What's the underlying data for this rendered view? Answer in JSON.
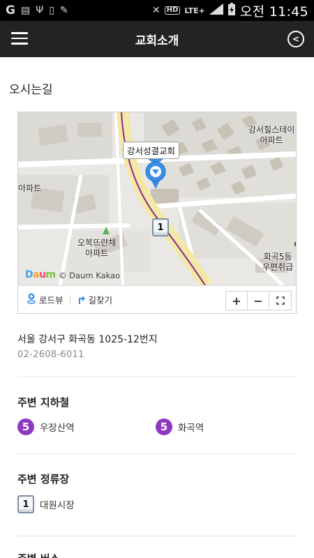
{
  "status_bar": {
    "time": "오전 11:45",
    "icons": [
      "g-icon",
      "storage-icon",
      "usb-icon",
      "phone-icon",
      "pen-icon",
      "mute-icon",
      "hd-icon",
      "lte-icon",
      "signal-icon",
      "battery-icon"
    ],
    "hd_label": "HD",
    "lte_label": "LTE+"
  },
  "app_bar": {
    "title": "교회소개"
  },
  "page": {
    "heading": "오시는길"
  },
  "map": {
    "church_label": "강서성결교회",
    "labels": {
      "top_right": "강서힐스테이\n아파트",
      "left": "아파트",
      "bottom_center": "오복뜨란채\n아파트",
      "bottom_right": "화곡5동\n우편취급"
    },
    "bus_stop_number": "1",
    "provider_logo": "Daum",
    "provider_copyright": "© Daum Kakao",
    "roadview_label": "로드뷰",
    "directions_label": "길찾기",
    "zoom_in": "+",
    "zoom_out": "−"
  },
  "info": {
    "address": "서울 강서구 화곡동 1025-12번지",
    "phone": "02-2608-6011"
  },
  "subway": {
    "heading": "주변 지하철",
    "stations": [
      {
        "line": "5",
        "name": "우장산역"
      },
      {
        "line": "5",
        "name": "화곡역"
      }
    ]
  },
  "bus_stop": {
    "heading": "주변 정류장",
    "stops": [
      {
        "number": "1",
        "name": "대원시장"
      }
    ]
  },
  "next_section": {
    "heading": "주변 버스"
  },
  "colors": {
    "app_bar": "#232323",
    "subway_line_5": "#8e3ac0",
    "marker": "#3a8ee6",
    "road": "#f3e8a6"
  }
}
